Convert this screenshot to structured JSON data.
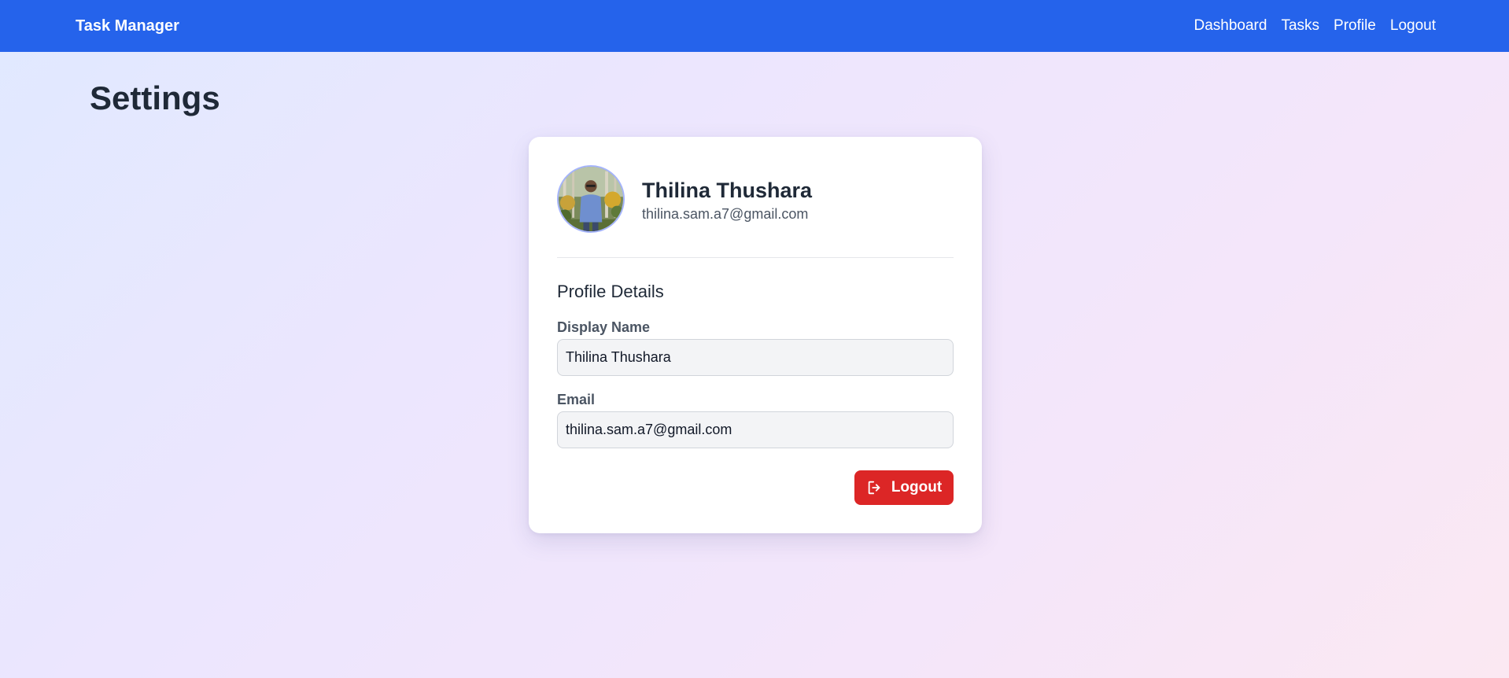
{
  "navbar": {
    "brand": "Task Manager",
    "links": [
      "Dashboard",
      "Tasks",
      "Profile",
      "Logout"
    ],
    "background_color": "#2563eb"
  },
  "page": {
    "title": "Settings"
  },
  "profile_card": {
    "avatar_icon": "user-photo",
    "name": "Thilina Thushara",
    "email": "thilina.sam.a7@gmail.com",
    "section_title": "Profile Details",
    "fields": {
      "display_name": {
        "label": "Display Name",
        "value": "Thilina Thushara"
      },
      "email": {
        "label": "Email",
        "value": "thilina.sam.a7@gmail.com"
      }
    },
    "logout_button": {
      "label": "Logout",
      "icon": "logout-icon",
      "color": "#dc2626"
    }
  }
}
